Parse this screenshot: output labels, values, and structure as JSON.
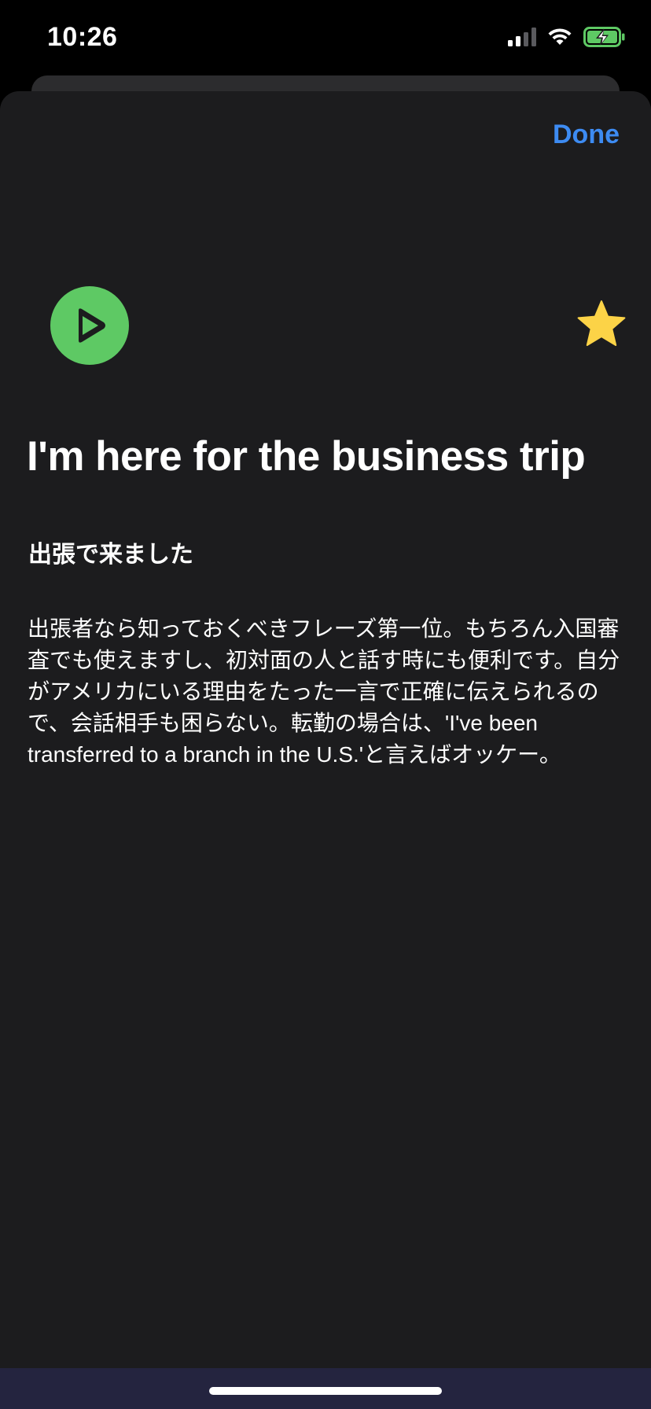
{
  "status_bar": {
    "time": "10:26"
  },
  "sheet": {
    "done_label": "Done",
    "title": "I'm here for the business trip",
    "translation": "出張で来ました",
    "description": "出張者なら知っておくべきフレーズ第一位。もちろん入国審査でも使えますし、初対面の人と話す時にも便利です。自分がアメリカにいる理由をたった一言で正確に伝えられるので、会話相手も困らない。転勤の場合は、'I've been transferred to a branch in the U.S.'と言えばオッケー。",
    "favorited": true
  },
  "colors": {
    "accent": "#3d8bf2",
    "play": "#5ec964",
    "star": "#fcd347",
    "sheet_bg": "#1c1c1e",
    "bottom_bar": "#24243f"
  },
  "icons": {
    "play": "play-icon",
    "star": "star-icon",
    "signal": "cellular-signal-icon",
    "wifi": "wifi-icon",
    "battery": "battery-charging-icon"
  }
}
